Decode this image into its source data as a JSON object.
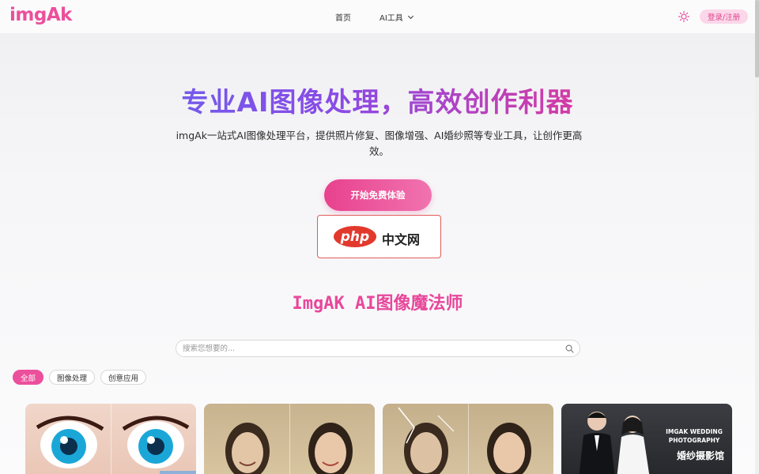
{
  "header": {
    "logo": "imgAk",
    "nav": [
      {
        "label": "首页"
      },
      {
        "label": "AI工具"
      }
    ],
    "theme_icon": "sun-icon",
    "login_label": "登录/注册"
  },
  "hero": {
    "title": "专业AI图像处理，高效创作利器",
    "description": "imgAk一站式AI图像处理平台，提供照片修复、图像增强、AI婚纱照等专业工具，让创作更高效。",
    "cta_label": "开始免费体验",
    "banner": {
      "logo_text": "php",
      "name": "中文网"
    }
  },
  "tools": {
    "title": "ImgAK AI图像魔法师",
    "search_placeholder": "搜索您想要的...",
    "tags": [
      {
        "label": "全部",
        "active": true
      },
      {
        "label": "图像处理",
        "active": false
      },
      {
        "label": "创意应用",
        "active": false
      }
    ],
    "cards": [
      {
        "name": "anime-eyes-card"
      },
      {
        "name": "photo-colorize-card"
      },
      {
        "name": "photo-restore-card"
      },
      {
        "name": "wedding-photo-card",
        "overlay_title": "IMGAK WEDDING PHOTOGRAPHY",
        "overlay_subtitle": "婚纱摄影馆"
      }
    ]
  },
  "colors": {
    "accent": "#ec4f9b",
    "title_gradient_start": "#5b6cf2",
    "title_gradient_end": "#ee4ea0"
  }
}
